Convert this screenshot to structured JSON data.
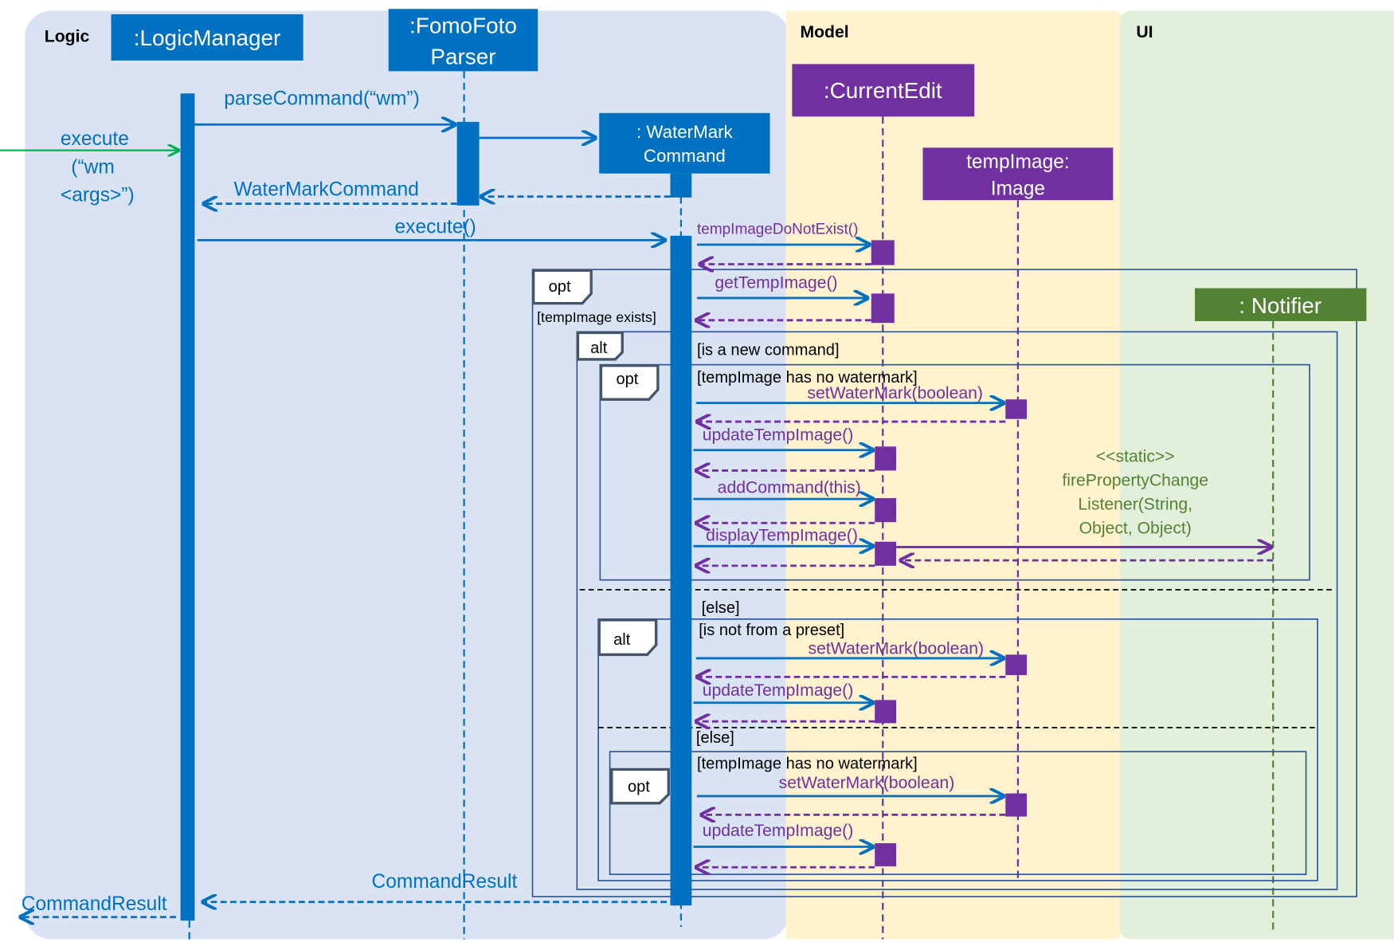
{
  "regions": {
    "logic": "Logic",
    "model": "Model",
    "ui": "UI"
  },
  "participants": {
    "logic_manager": ":LogicManager",
    "parser_line1": ":FomoFoto",
    "parser_line2": "Parser",
    "watermark_line1": ": WaterMark",
    "watermark_line2": "Command",
    "current_edit": ":CurrentEdit",
    "temp_image_line1": "tempImage:",
    "temp_image_line2": "Image",
    "notifier": ": Notifier"
  },
  "messages": {
    "execute_line1": "execute",
    "execute_line2": "(“wm",
    "execute_line3": "<args>”)",
    "parse_command": "parseCommand(“wm”)",
    "watermark_command": "WaterMarkCommand",
    "execute_call": "execute()",
    "temp_image_do_not_exist": "tempImageDoNotExist()",
    "get_temp_image": "getTempImage()",
    "set_watermark_1": "setWaterMark(boolean)",
    "update_temp_image_1": "updateTempImage()",
    "add_command": "addCommand(this)",
    "display_temp_image": "displayTempImage()",
    "fire_line1": "<<static>>",
    "fire_line2": "firePropertyChange",
    "fire_line3": "Listener(String,",
    "fire_line4": "Object, Object)",
    "set_watermark_2": "setWaterMark(boolean)",
    "update_temp_image_2": "updateTempImage()",
    "set_watermark_3": "setWaterMark(boolean)",
    "update_temp_image_3": "updateTempImage()",
    "command_result_1": "CommandResult",
    "command_result_2": "CommandResult"
  },
  "fragments": {
    "opt1": {
      "tag": "opt",
      "guard": "[tempImage exists]"
    },
    "alt1": {
      "tag": "alt",
      "guard": "[is a new command]",
      "else": "[else]"
    },
    "opt2": {
      "tag": "opt",
      "guard": "[tempImage has no watermark]"
    },
    "alt2": {
      "tag": "alt",
      "guard": "[is not from a preset]",
      "else": "[else]"
    },
    "opt3": {
      "tag": "opt",
      "guard": "[tempImage has no watermark]"
    }
  },
  "colors": {
    "logic_bg": "#dae3f3",
    "model_bg": "#fff2cc",
    "ui_bg": "#e2efda",
    "logic_blue": "#0070c0",
    "model_purple": "#7030a0",
    "ui_green": "#548235",
    "entry_arrow": "#00b050",
    "fragment": "#2f5597"
  }
}
